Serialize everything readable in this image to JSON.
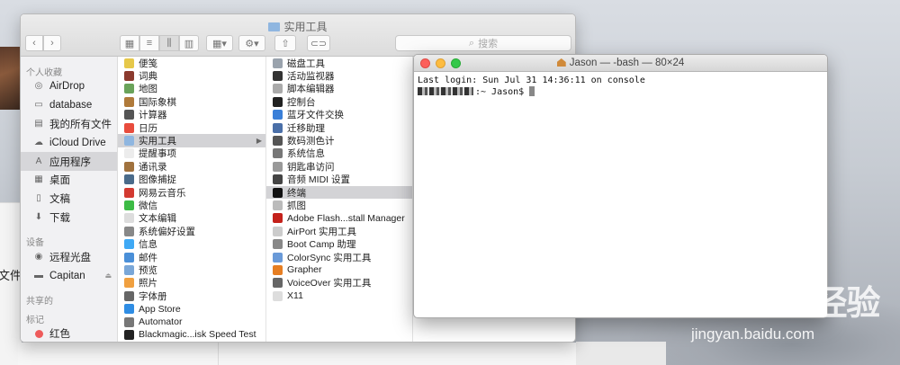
{
  "finder": {
    "title": "实用工具",
    "search_placeholder": "搜索",
    "sidebar": {
      "favorites_heading": "个人收藏",
      "favorites": [
        {
          "label": "AirDrop",
          "icon": "airdrop-icon"
        },
        {
          "label": "database",
          "icon": "folder-icon"
        },
        {
          "label": "我的所有文件",
          "icon": "all-files-icon"
        },
        {
          "label": "iCloud Drive",
          "icon": "cloud-icon"
        },
        {
          "label": "应用程序",
          "icon": "applications-icon",
          "active": true
        },
        {
          "label": "桌面",
          "icon": "desktop-icon"
        },
        {
          "label": "文稿",
          "icon": "documents-icon"
        },
        {
          "label": "下载",
          "icon": "download-icon"
        }
      ],
      "devices_heading": "设备",
      "devices": [
        {
          "label": "远程光盘",
          "icon": "disc-icon"
        },
        {
          "label": "Capitan",
          "icon": "drive-icon"
        }
      ],
      "shared_heading": "共享的",
      "tags_heading": "标记",
      "tags": [
        {
          "label": "红色",
          "color": "#ee5b5b"
        }
      ]
    },
    "column1": [
      {
        "label": "便笺",
        "color": "#e6c84a"
      },
      {
        "label": "词典",
        "color": "#8b3a2e"
      },
      {
        "label": "地图",
        "color": "#6aa35a"
      },
      {
        "label": "国际象棋",
        "color": "#b07a3a"
      },
      {
        "label": "计算器",
        "color": "#555555"
      },
      {
        "label": "日历",
        "color": "#e84c3d"
      },
      {
        "label": "实用工具",
        "color": "#8fb6e0",
        "selected": true
      },
      {
        "label": "提醒事项",
        "color": "#ececec"
      },
      {
        "label": "通讯录",
        "color": "#a0723e"
      },
      {
        "label": "图像捕捉",
        "color": "#4a6b8a"
      },
      {
        "label": "网易云音乐",
        "color": "#d33a31"
      },
      {
        "label": "微信",
        "color": "#3dbb45"
      },
      {
        "label": "文本编辑",
        "color": "#dddddd"
      },
      {
        "label": "系统偏好设置",
        "color": "#888888"
      },
      {
        "label": "信息",
        "color": "#3fa9f5"
      },
      {
        "label": "邮件",
        "color": "#4a8fd8"
      },
      {
        "label": "预览",
        "color": "#7aa7d8"
      },
      {
        "label": "照片",
        "color": "#f0a040"
      },
      {
        "label": "字体册",
        "color": "#666666"
      },
      {
        "label": "App Store",
        "color": "#2f8de4"
      },
      {
        "label": "Automator",
        "color": "#777777"
      },
      {
        "label": "Blackmagic...isk Speed Test",
        "color": "#222222"
      }
    ],
    "column2": [
      {
        "label": "磁盘工具",
        "color": "#9aa3ad"
      },
      {
        "label": "活动监视器",
        "color": "#333333"
      },
      {
        "label": "脚本编辑器",
        "color": "#aaaaaa"
      },
      {
        "label": "控制台",
        "color": "#222222"
      },
      {
        "label": "蓝牙文件交换",
        "color": "#3a7fd8"
      },
      {
        "label": "迁移助理",
        "color": "#4a6fa8"
      },
      {
        "label": "数码测色计",
        "color": "#555555"
      },
      {
        "label": "系统信息",
        "color": "#777777"
      },
      {
        "label": "钥匙串访问",
        "color": "#999999"
      },
      {
        "label": "音频 MIDI 设置",
        "color": "#444444"
      },
      {
        "label": "终端",
        "color": "#111111",
        "selected": true
      },
      {
        "label": "抓图",
        "color": "#bbbbbb"
      },
      {
        "label": "Adobe Flash...stall Manager",
        "color": "#c4211b"
      },
      {
        "label": "AirPort 实用工具",
        "color": "#cccccc"
      },
      {
        "label": "Boot Camp 助理",
        "color": "#888888"
      },
      {
        "label": "ColorSync 实用工具",
        "color": "#6a9ad8"
      },
      {
        "label": "Grapher",
        "color": "#e67e22"
      },
      {
        "label": "VoiceOver 实用工具",
        "color": "#666666"
      },
      {
        "label": "X11",
        "color": "#dddddd"
      }
    ]
  },
  "terminal": {
    "title": "Jason — -bash — 80×24",
    "line1": "Last login: Sun Jul 31 14:36:11 on console",
    "prompt": ":~ Jason$ "
  },
  "desktop": {
    "doc_text": "文件夹"
  },
  "watermark": {
    "logo": "Bai du 经验",
    "url": "jingyan.baidu.com"
  }
}
